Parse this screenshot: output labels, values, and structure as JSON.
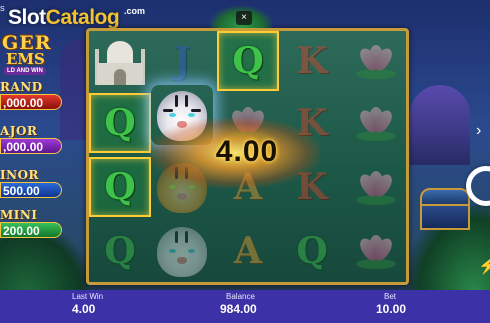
{
  "watermark": {
    "slot": "Slot",
    "catalog": "Catalog",
    "com": ".com"
  },
  "logo": {
    "title_line1": "GER",
    "title_line2": "EMS",
    "subtitle": "LD AND WIN",
    "small": "S"
  },
  "jackpots": [
    {
      "label": "RAND",
      "value": ",000.00",
      "color": "#e33a2a"
    },
    {
      "label": "AJOR",
      "value": ",000.00",
      "color": "#a13ad8"
    },
    {
      "label": "INOR",
      "value": "500.00",
      "color": "#2a6ad8"
    },
    {
      "label": "MINI",
      "value": "200.00",
      "color": "#36c05a"
    }
  ],
  "reels": {
    "columns": [
      [
        "taj-mahal",
        "Q",
        "Q",
        "Q"
      ],
      [
        "tiger",
        "tiger",
        "tiger",
        "tiger"
      ],
      [
        "Q",
        "lotus",
        "A",
        "A"
      ],
      [
        "K",
        "K",
        "K",
        "Q"
      ],
      [
        "lotus",
        "lotus",
        "lotus",
        "lotus"
      ]
    ],
    "letters": {
      "c0r1": "Q",
      "c0r2": "Q",
      "c0r3": "Q",
      "c2r0": "Q",
      "c2r2": "A",
      "c2r3": "A",
      "c3r0": "K",
      "c3r1": "K",
      "c3r2": "K",
      "c3r3": "Q",
      "c1r0": "J"
    }
  },
  "win": {
    "amount": "4.00"
  },
  "close_icon": "×",
  "bottom": {
    "last_win_label": "Last Win",
    "last_win_value": "4.00",
    "balance_label": "Balance",
    "balance_value": "984.00",
    "bet_label": "Bet",
    "bet_value": "10.00"
  },
  "colors": {
    "frame": "#c79a3a",
    "bottom_bar": "#3d31a8",
    "highlight": "#ffcc33"
  },
  "icons": {
    "side_arrow": "›",
    "spin": "spin-ring-icon",
    "turbo": "⚡"
  }
}
